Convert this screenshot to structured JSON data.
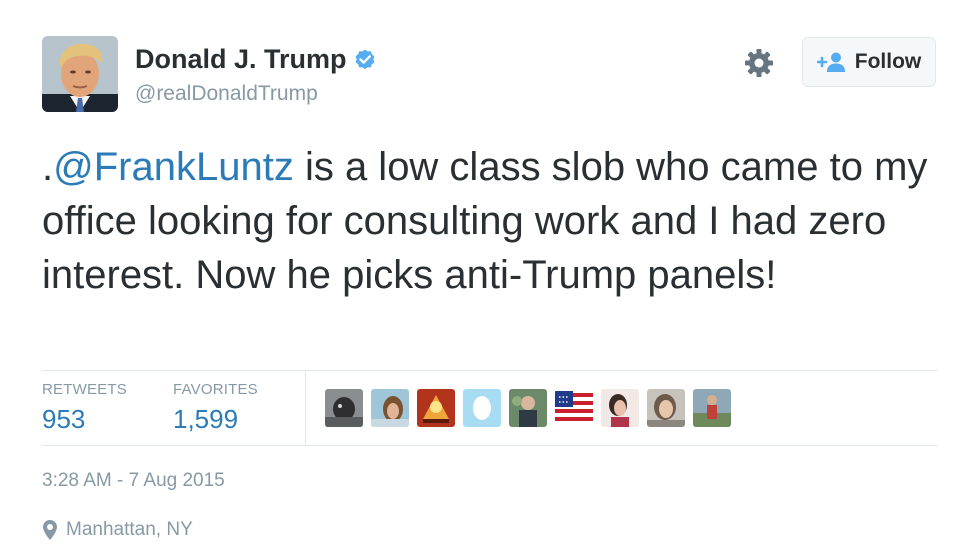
{
  "author": {
    "display_name": "Donald J. Trump",
    "handle": "@realDonaldTrump",
    "verified": true
  },
  "actions": {
    "settings_icon": "gear-icon",
    "follow_label": "Follow"
  },
  "tweet": {
    "prefix": ".",
    "mention": "@FrankLuntz",
    "body": " is a low class slob who came to my office looking for consulting work and I had zero interest. Now he picks anti-Trump panels!"
  },
  "stats": {
    "retweets_label": "RETWEETS",
    "retweets_value": "953",
    "favorites_label": "FAVORITES",
    "favorites_value": "1,599"
  },
  "timestamp": "3:28 AM - 7 Aug 2015",
  "location": "Manhattan, NY",
  "colors": {
    "link": "#2b7bb9",
    "verified": "#55acee",
    "muted": "#8899a6",
    "text": "#292f33"
  }
}
